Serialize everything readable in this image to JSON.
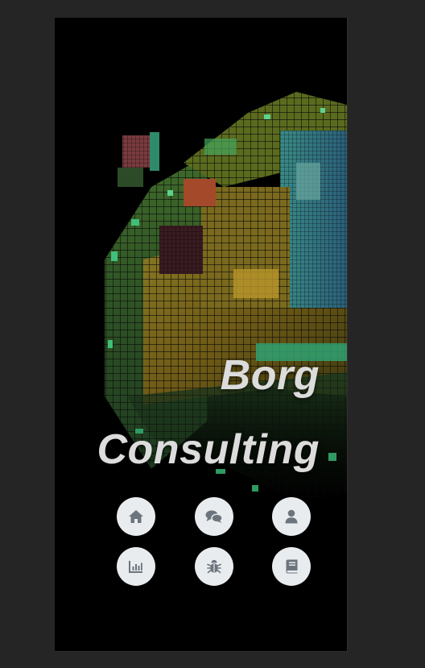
{
  "brand": {
    "line1": "Borg",
    "line2": "Consulting"
  },
  "hero": {
    "image": "borg-cube-artwork"
  },
  "colors": {
    "page_background": "#252525",
    "panel_background": "#000000",
    "title_text": "#dcdcdc",
    "button_background": "#e9ecef",
    "icon_color": "#6c757d"
  },
  "nav": {
    "buttons": [
      {
        "icon": "home-icon"
      },
      {
        "icon": "chat-icon"
      },
      {
        "icon": "user-icon"
      },
      {
        "icon": "chart-icon"
      },
      {
        "icon": "bug-icon"
      },
      {
        "icon": "book-icon"
      }
    ]
  }
}
